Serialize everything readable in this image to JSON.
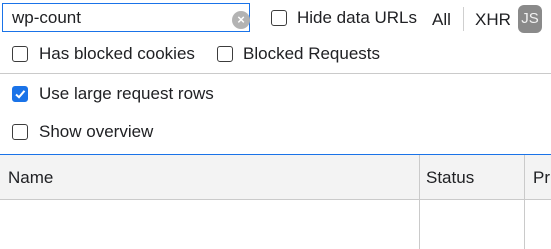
{
  "toolbar": {
    "filter_value": "wp-count",
    "clear_glyph": "×",
    "hide_data_urls": {
      "label": "Hide data URLs",
      "checked": false
    },
    "type_filters": [
      "All",
      "XHR"
    ],
    "js_badge": "JS"
  },
  "row2": {
    "has_blocked_cookies": {
      "label": "Has blocked cookies",
      "checked": false
    },
    "blocked_requests": {
      "label": "Blocked Requests",
      "checked": false
    }
  },
  "settings": {
    "large_rows": {
      "label": "Use large request rows",
      "checked": true
    },
    "show_overview": {
      "label": "Show overview",
      "checked": false
    }
  },
  "table": {
    "columns": [
      "Name",
      "Status",
      "Pr"
    ]
  },
  "colors": {
    "accent": "#1a73e8",
    "header_bg": "#f3f3f3"
  }
}
